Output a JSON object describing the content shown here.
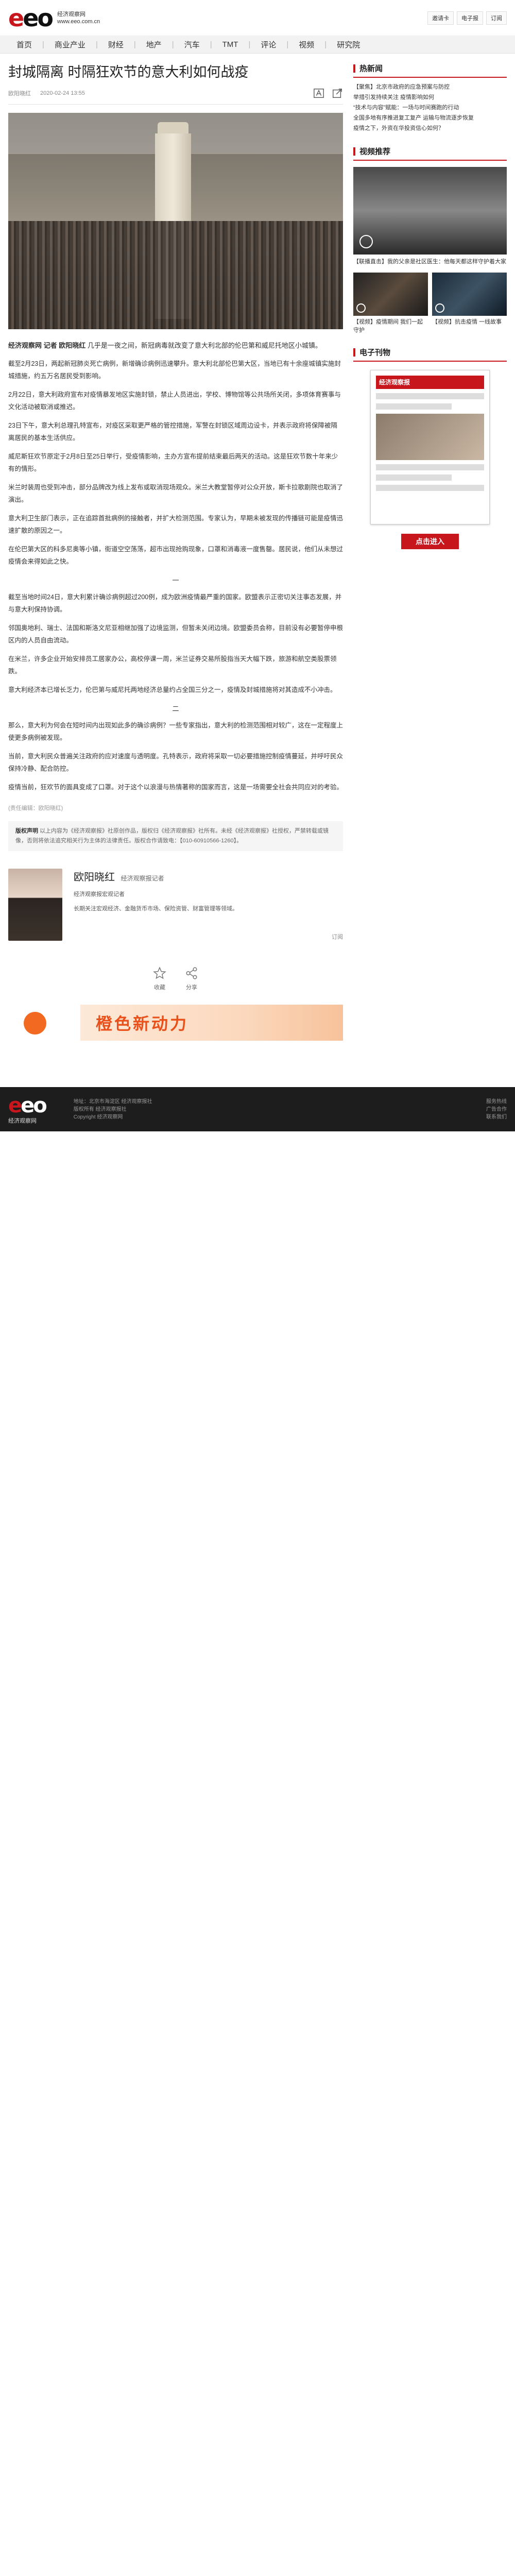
{
  "site": {
    "logo_mark": "eeo",
    "logo_cn": "经济观察网",
    "logo_url": "www.eeo.com.cn"
  },
  "toplinks": [
    "邀请卡",
    "电子报",
    "订阅"
  ],
  "nav": [
    "首页",
    "商业产业",
    "财经",
    "地产",
    "汽车",
    "TMT",
    "评论",
    "视频",
    "研究院"
  ],
  "article": {
    "title": "封城隔离 时隔狂欢节的意大利如何战疫",
    "author": "欧阳晓红",
    "date": "2020-02-24 13:55",
    "lead_byline": "经济观察网 记者 欧阳晓红",
    "lead_text": "几乎是一夜之间，新冠病毒就改变了意大利北部的伦巴第和威尼托地区小城镇。",
    "paragraphs": [
      "截至2月23日，两起新冠肺炎死亡病例，新增确诊病例迅速攀升。意大利北部伦巴第大区，当地已有十余座城镇实施封城措施，约五万名居民受到影响。",
      "2月22日，意大利政府宣布对疫情暴发地区实施封锁，禁止人员进出，学校、博物馆等公共场所关闭，多项体育赛事与文化活动被取消或推迟。",
      "23日下午，意大利总理孔特宣布，对疫区采取更严格的管控措施，军警在封锁区域周边设卡，并表示政府将保障被隔离居民的基本生活供应。",
      "威尼斯狂欢节原定于2月8日至25日举行，受疫情影响，主办方宣布提前结束最后两天的活动。这是狂欢节数十年来少有的情形。",
      "米兰时装周也受到冲击，部分品牌改为线上发布或取消现场观众。米兰大教堂暂停对公众开放，斯卡拉歌剧院也取消了演出。",
      "意大利卫生部门表示，正在追踪首批病例的接触者，并扩大检测范围。专家认为，早期未被发现的传播链可能是疫情迅速扩散的原因之一。",
      "在伦巴第大区的科多尼奥等小镇，街道空空荡荡，超市出现抢购现象，口罩和消毒液一度售罄。居民说，他们从未想过疫情会来得如此之快。"
    ],
    "chapter_one": "一",
    "chapter_one_paras": [
      "截至当地时间24日，意大利累计确诊病例超过200例，成为欧洲疫情最严重的国家。欧盟表示正密切关注事态发展，并与意大利保持协调。",
      "邻国奥地利、瑞士、法国和斯洛文尼亚相继加强了边境监测，但暂未关闭边境。欧盟委员会称，目前没有必要暂停申根区内的人员自由流动。",
      "在米兰，许多企业开始安排员工居家办公，高校停课一周，米兰证券交易所股指当天大幅下跌，旅游和航空类股票领跌。",
      "意大利经济本已增长乏力，伦巴第与威尼托两地经济总量约占全国三分之一，疫情及封城措施将对其造成不小冲击。"
    ],
    "chapter_two": "二",
    "chapter_two_paras": [
      "那么，意大利为何会在短时间内出现如此多的确诊病例？一些专家指出，意大利的检测范围相对较广，这在一定程度上使更多病例被发现。",
      "当前，意大利民众普遍关注政府的应对速度与透明度。孔特表示，政府将采取一切必要措施控制疫情蔓延，并呼吁民众保持冷静、配合防控。",
      "疫情当前，狂欢节的面具变成了口罩。对于这个以浪漫与热情著称的国家而言，这是一场需要全社会共同应对的考验。"
    ],
    "source_note": "(责任编辑：欧阳晓红)",
    "reprint_label": "版权声明",
    "reprint_text": "以上内容为《经济观察报》社原创作品，版权归《经济观察报》社所有。未经《经济观察报》社授权，严禁转载或镜像，否则将依法追究相关行为主体的法律责任。版权合作请致电：【010-60910566-1260】。"
  },
  "author_card": {
    "name": "欧阳晓红",
    "role": "经济观察报记者",
    "title_line": "经济观察报宏观记者",
    "desc": "长期关注宏观经济、金融货币市场、保险资管、财富管理等领域。",
    "follow": "订阅"
  },
  "actions": [
    "收藏",
    "分享"
  ],
  "banner_text": "橙色新动力",
  "sidebar": {
    "hot_title": "热新闻",
    "hot_items": [
      "【聚焦】北京市政府的应急预案与防控",
      "举措引发持续关注 疫情影响如何",
      "“技术与内容”赋能：一场与时间赛跑的行动",
      "全国多地有序推进复工复产 运输与物流逐步恢复",
      "疫情之下，外资在华投资信心如何？"
    ],
    "video_title": "视频推荐",
    "video_main_caption": "【联播直击】我的父亲是社区医生：他每天都这样守护着大家",
    "video_items": [
      "【视频】疫情期间 我们一起守护",
      "【视频】抗击疫情 一线故事"
    ],
    "epaper_title": "电子刊物",
    "epaper_mast": "经济观察报",
    "epaper_button": "点击进入"
  },
  "footer": {
    "logo_mark": "eeo",
    "logo_cn": "经济观察网",
    "info_lines": [
      "地址：北京市海淀区 经济观察报社",
      "版权所有 经济观察报社",
      "Copyright 经济观察网"
    ],
    "right_lines": [
      "服务热线",
      "广告合作",
      "联系我们"
    ]
  }
}
